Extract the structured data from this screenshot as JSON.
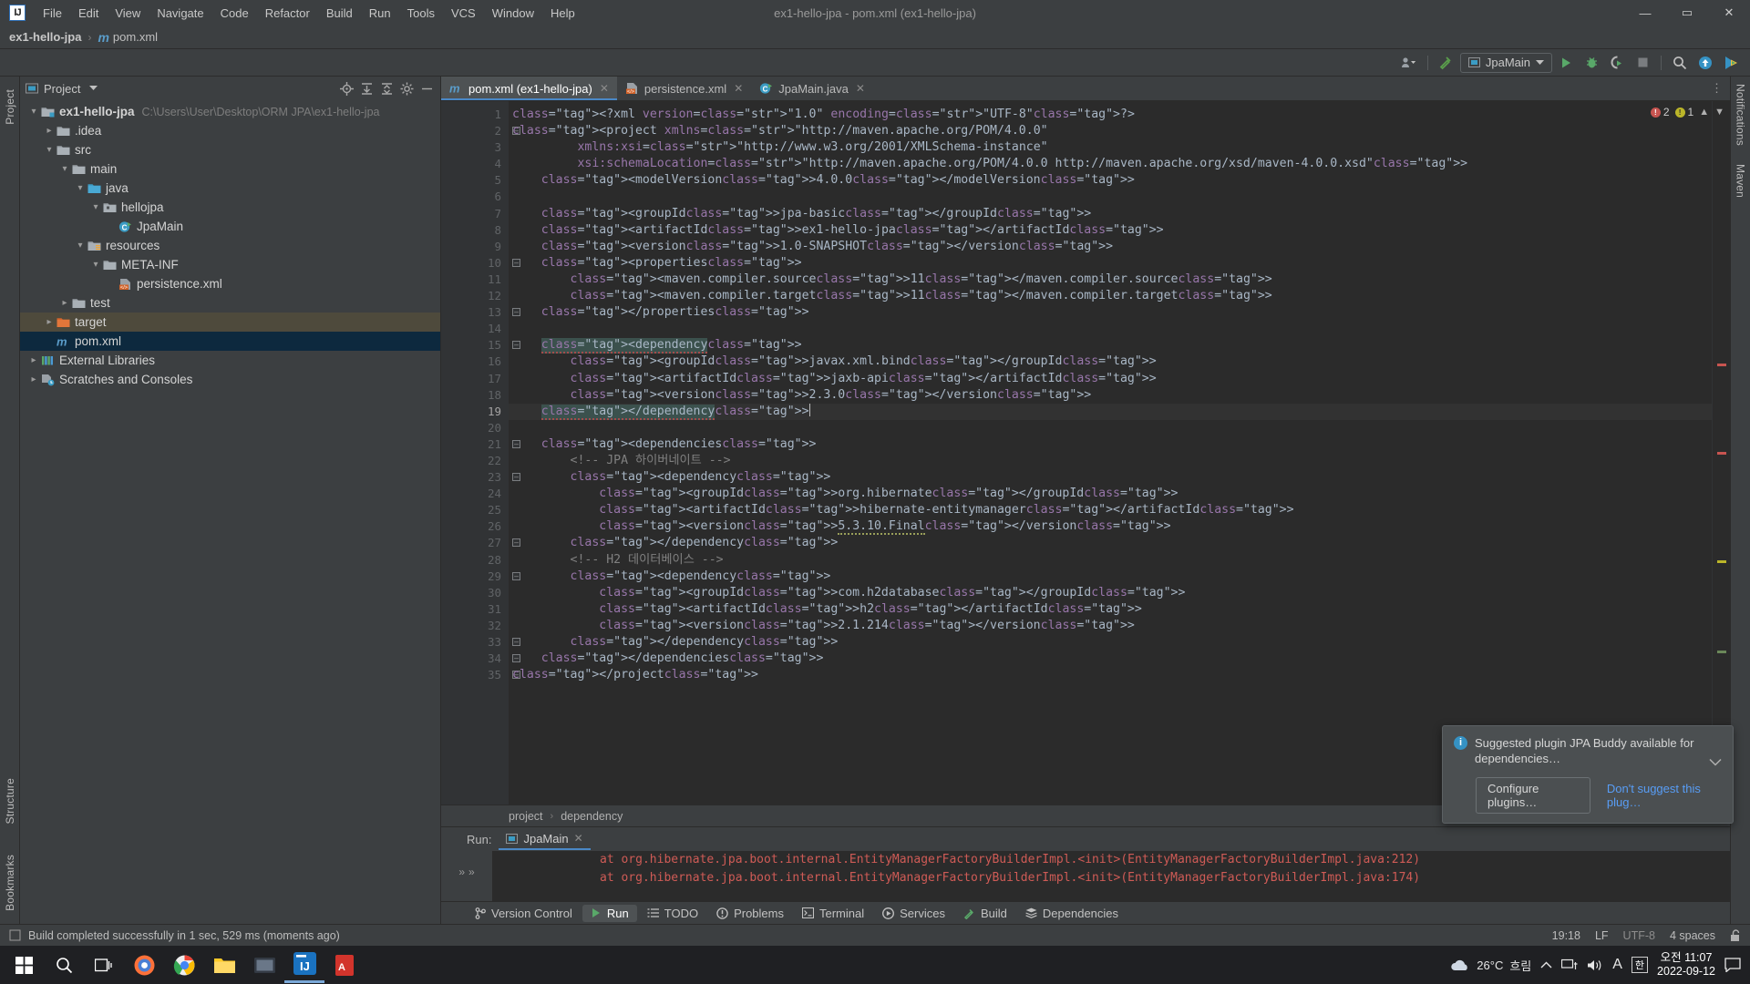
{
  "window": {
    "title": "ex1-hello-jpa - pom.xml (ex1-hello-jpa)",
    "minimize": "—",
    "maximize": "▭",
    "close": "✕"
  },
  "menu": {
    "items": [
      "File",
      "Edit",
      "View",
      "Navigate",
      "Code",
      "Refactor",
      "Build",
      "Run",
      "Tools",
      "VCS",
      "Window",
      "Help"
    ]
  },
  "navbar": {
    "project": "ex1-hello-jpa",
    "separator": "›",
    "file": "pom.xml",
    "file_icon": "m"
  },
  "toolbar": {
    "run_config": "JpaMain",
    "icons": [
      "user-accounts-icon",
      "build-icon",
      "run-icon",
      "debug-icon",
      "run-with-coverage-icon",
      "stop-icon",
      "search-everywhere-icon",
      "update-project-icon",
      "ide-feature-icon"
    ]
  },
  "project_panel": {
    "title": "Project",
    "vertical_tab": "Project",
    "tree": [
      {
        "depth": 0,
        "label": "ex1-hello-jpa",
        "path": "C:\\Users\\User\\Desktop\\ORM JPA\\ex1-hello-jpa",
        "arrow": "expanded",
        "icon": "module-folder",
        "bold": true,
        "state": "none"
      },
      {
        "depth": 1,
        "label": ".idea",
        "path": "",
        "arrow": "collapsed",
        "icon": "folder",
        "bold": false,
        "state": "none"
      },
      {
        "depth": 1,
        "label": "src",
        "path": "",
        "arrow": "expanded",
        "icon": "folder",
        "bold": false,
        "state": "none"
      },
      {
        "depth": 2,
        "label": "main",
        "path": "",
        "arrow": "expanded",
        "icon": "folder",
        "bold": false,
        "state": "none"
      },
      {
        "depth": 3,
        "label": "java",
        "path": "",
        "arrow": "expanded",
        "icon": "source-folder",
        "bold": false,
        "state": "none"
      },
      {
        "depth": 4,
        "label": "hellojpa",
        "path": "",
        "arrow": "expanded",
        "icon": "package",
        "bold": false,
        "state": "none"
      },
      {
        "depth": 5,
        "label": "JpaMain",
        "path": "",
        "arrow": "none",
        "icon": "java-class-run",
        "bold": false,
        "state": "none"
      },
      {
        "depth": 3,
        "label": "resources",
        "path": "",
        "arrow": "expanded",
        "icon": "resource-folder",
        "bold": false,
        "state": "none"
      },
      {
        "depth": 4,
        "label": "META-INF",
        "path": "",
        "arrow": "expanded",
        "icon": "folder",
        "bold": false,
        "state": "none"
      },
      {
        "depth": 5,
        "label": "persistence.xml",
        "path": "",
        "arrow": "none",
        "icon": "xml-file",
        "bold": false,
        "state": "none"
      },
      {
        "depth": 2,
        "label": "test",
        "path": "",
        "arrow": "collapsed",
        "icon": "folder",
        "bold": false,
        "state": "none"
      },
      {
        "depth": 1,
        "label": "target",
        "path": "",
        "arrow": "collapsed",
        "icon": "excluded-folder",
        "bold": false,
        "state": "highlight"
      },
      {
        "depth": 1,
        "label": "pom.xml",
        "path": "",
        "arrow": "none",
        "icon": "maven-file",
        "bold": false,
        "state": "selected"
      },
      {
        "depth": 0,
        "label": "External Libraries",
        "path": "",
        "arrow": "collapsed",
        "icon": "libraries",
        "bold": false,
        "state": "none"
      },
      {
        "depth": 0,
        "label": "Scratches and Consoles",
        "path": "",
        "arrow": "collapsed",
        "icon": "scratches",
        "bold": false,
        "state": "none"
      }
    ]
  },
  "editor": {
    "tabs": [
      {
        "label": "pom.xml (ex1-hello-jpa)",
        "icon": "maven-file",
        "active": true,
        "close": "✕"
      },
      {
        "label": "persistence.xml",
        "icon": "xml-file",
        "active": false,
        "close": "✕"
      },
      {
        "label": "JpaMain.java",
        "icon": "java-class-run",
        "active": false,
        "close": "✕"
      }
    ],
    "inspection": {
      "errors": "2",
      "warnings": "1",
      "error_icon": "error-dot",
      "warning_icon": "warning-dot"
    },
    "breadcrumb": [
      "project",
      "dependency"
    ],
    "caret_line": 19,
    "lines": [
      {
        "n": 1,
        "fold": "none",
        "text": "<?xml version=\"1.0\" encoding=\"UTF-8\"?>"
      },
      {
        "n": 2,
        "fold": "open",
        "text": "<project xmlns=\"http://maven.apache.org/POM/4.0.0\""
      },
      {
        "n": 3,
        "fold": "none",
        "text": "         xmlns:xsi=\"http://www.w3.org/2001/XMLSchema-instance\""
      },
      {
        "n": 4,
        "fold": "none",
        "text": "         xsi:schemaLocation=\"http://maven.apache.org/POM/4.0.0 http://maven.apache.org/xsd/maven-4.0.0.xsd\">"
      },
      {
        "n": 5,
        "fold": "none",
        "text": "    <modelVersion>4.0.0</modelVersion>"
      },
      {
        "n": 6,
        "fold": "none",
        "text": ""
      },
      {
        "n": 7,
        "fold": "none",
        "text": "    <groupId>jpa-basic</groupId>"
      },
      {
        "n": 8,
        "fold": "none",
        "text": "    <artifactId>ex1-hello-jpa</artifactId>"
      },
      {
        "n": 9,
        "fold": "none",
        "text": "    <version>1.0-SNAPSHOT</version>"
      },
      {
        "n": 10,
        "fold": "open",
        "text": "    <properties>"
      },
      {
        "n": 11,
        "fold": "none",
        "text": "        <maven.compiler.source>11</maven.compiler.source>"
      },
      {
        "n": 12,
        "fold": "none",
        "text": "        <maven.compiler.target>11</maven.compiler.target>"
      },
      {
        "n": 13,
        "fold": "close",
        "text": "    </properties>"
      },
      {
        "n": 14,
        "fold": "none",
        "text": ""
      },
      {
        "n": 15,
        "fold": "open",
        "text": "    <dependency>"
      },
      {
        "n": 16,
        "fold": "none",
        "text": "        <groupId>javax.xml.bind</groupId>"
      },
      {
        "n": 17,
        "fold": "none",
        "text": "        <artifactId>jaxb-api</artifactId>"
      },
      {
        "n": 18,
        "fold": "none",
        "text": "        <version>2.3.0</version>"
      },
      {
        "n": 19,
        "fold": "close",
        "text": "    </dependency>"
      },
      {
        "n": 20,
        "fold": "none",
        "text": ""
      },
      {
        "n": 21,
        "fold": "open",
        "text": "    <dependencies>"
      },
      {
        "n": 22,
        "fold": "none",
        "text": "        <!-- JPA 하이버네이트 -->"
      },
      {
        "n": 23,
        "fold": "open",
        "text": "        <dependency>"
      },
      {
        "n": 24,
        "fold": "none",
        "text": "            <groupId>org.hibernate</groupId>"
      },
      {
        "n": 25,
        "fold": "none",
        "text": "            <artifactId>hibernate-entitymanager</artifactId>"
      },
      {
        "n": 26,
        "fold": "none",
        "text": "            <version>5.3.10.Final</version>"
      },
      {
        "n": 27,
        "fold": "close",
        "text": "        </dependency>"
      },
      {
        "n": 28,
        "fold": "none",
        "text": "        <!-- H2 데이터베이스 -->"
      },
      {
        "n": 29,
        "fold": "open",
        "text": "        <dependency>"
      },
      {
        "n": 30,
        "fold": "none",
        "text": "            <groupId>com.h2database</groupId>"
      },
      {
        "n": 31,
        "fold": "none",
        "text": "            <artifactId>h2</artifactId>"
      },
      {
        "n": 32,
        "fold": "none",
        "text": "            <version>2.1.214</version>"
      },
      {
        "n": 33,
        "fold": "close",
        "text": "        </dependency>"
      },
      {
        "n": 34,
        "fold": "close",
        "text": "    </dependencies>"
      },
      {
        "n": 35,
        "fold": "close",
        "text": "</project>"
      }
    ]
  },
  "run_window": {
    "label": "Run:",
    "tab": "JpaMain",
    "tab_close": "✕",
    "console_lines": [
      "at org.hibernate.jpa.boot.internal.EntityManagerFactoryBuilderImpl.<init>(EntityManagerFactoryBuilderImpl.java:212)",
      "at org.hibernate.jpa.boot.internal.EntityManagerFactoryBuilderImpl.<init>(EntityManagerFactoryBuilderImpl.java:174)"
    ]
  },
  "tool_window_bar": {
    "items": [
      {
        "label": "Version Control",
        "icon": "branch-icon",
        "active": false
      },
      {
        "label": "Run",
        "icon": "run-icon",
        "active": true
      },
      {
        "label": "TODO",
        "icon": "todo-icon",
        "active": false
      },
      {
        "label": "Problems",
        "icon": "problems-icon",
        "active": false
      },
      {
        "label": "Terminal",
        "icon": "terminal-icon",
        "active": false
      },
      {
        "label": "Services",
        "icon": "services-icon",
        "active": false
      },
      {
        "label": "Build",
        "icon": "build-icon",
        "active": false
      },
      {
        "label": "Dependencies",
        "icon": "dependencies-icon",
        "active": false
      }
    ]
  },
  "right_strip": {
    "tabs": [
      "Notifications",
      "Maven"
    ]
  },
  "left_strip_bottom": {
    "tabs": [
      "Structure",
      "Bookmarks"
    ]
  },
  "statusbar": {
    "message": "Build completed successfully in 1 sec, 529 ms (moments ago)",
    "caret_position": "19:18",
    "line_separator": "LF",
    "encoding": "UTF-8",
    "indent": "4 spaces",
    "lock_icon": "unlocked-icon"
  },
  "notification": {
    "title": "Suggested plugin JPA Buddy available for dependencies…",
    "info_icon": "info-icon",
    "collapse_icon": "chevron-down-icon",
    "primary_button": "Configure plugins…",
    "secondary_link": "Don't suggest this plug…"
  },
  "taskbar": {
    "icons": [
      "windows-start-icon",
      "search-icon",
      "task-view-icon",
      "firefox-icon",
      "chrome-icon",
      "file-explorer-icon",
      "media-icon",
      "intellij-icon",
      "pdf-icon"
    ],
    "weather_temp": "26°C",
    "weather_desc": "흐림",
    "tray": [
      "chevron-up-icon",
      "network-icon",
      "volume-icon",
      "language-A-icon"
    ],
    "ime": "한",
    "clock_time": "오전 11:07",
    "clock_date": "2022-09-12",
    "notification_icon": "action-center-icon"
  },
  "colors": {
    "accent": "#4a88c7",
    "selection": "#0d293e",
    "error": "#c75450",
    "warning": "#bbb529",
    "tag": "#e8bf6a",
    "string": "#6a8759",
    "link": "#589df6"
  }
}
